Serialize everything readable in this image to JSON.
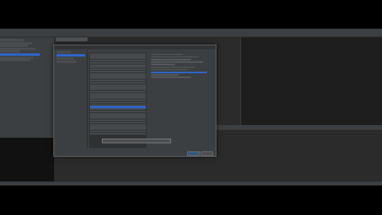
{
  "window": {
    "title": ""
  },
  "menu": {
    "items": [
      "",
      "",
      "",
      "",
      "",
      "",
      "",
      "",
      "",
      ""
    ]
  },
  "dialog": {
    "title": "",
    "buttons": {
      "ok": "",
      "cancel": ""
    }
  },
  "colors": {
    "background": "#000000",
    "ide_bg": "#2b2b2b",
    "panel": "#3c3f41",
    "accent": "#2f65ca"
  }
}
